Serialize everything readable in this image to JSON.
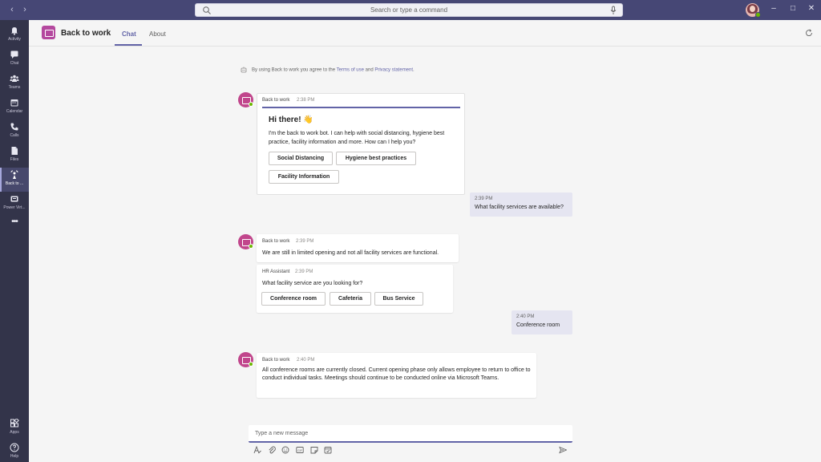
{
  "titlebar": {
    "search_placeholder": "Search or type a command",
    "back": "‹",
    "forward": "›",
    "minimize": "–",
    "maximize": "□",
    "close": "✕"
  },
  "rail": {
    "items": [
      {
        "label": "Activity",
        "icon": "bell-icon"
      },
      {
        "label": "Chat",
        "icon": "chat-icon"
      },
      {
        "label": "Teams",
        "icon": "teams-icon"
      },
      {
        "label": "Calendar",
        "icon": "calendar-icon"
      },
      {
        "label": "Calls",
        "icon": "phone-icon"
      },
      {
        "label": "Files",
        "icon": "file-icon"
      },
      {
        "label": "Back to ...",
        "icon": "back-to-work-icon"
      },
      {
        "label": "Power Virt...",
        "icon": "power-virtual-agents-icon"
      },
      {
        "label": "•••",
        "icon": "more-icon"
      }
    ],
    "apps_label": "Apps",
    "help_label": "Help"
  },
  "header": {
    "title": "Back to work",
    "tabs": [
      "Chat",
      "About"
    ]
  },
  "consent": {
    "prefix": "By using Back to work you agree to the",
    "terms": "Terms of use",
    "and": "and",
    "privacy": "Privacy statement",
    "suffix": "."
  },
  "messages": {
    "m1": {
      "sender": "Back to work",
      "time": "2:38 PM",
      "card_title": "Hi there! 👋",
      "card_text": "I'm the back to work bot.  I can help with social distancing, hygiene best practice, facility information and more.  How can I help you?",
      "buttons": [
        "Social Distancing",
        "Hygiene best practices",
        "Facility Information"
      ]
    },
    "m2": {
      "time": "2:39 PM",
      "text": "What facility services are available?"
    },
    "m3": {
      "sender": "Back to work",
      "time": "2:39 PM",
      "text": "We are still in limited opening and not all facility services are functional."
    },
    "m4": {
      "sender": "HR Assistant",
      "time": "2:39 PM",
      "text": "What facility service are you looking for?",
      "buttons": [
        "Conference room",
        "Cafeteria",
        "Bus Service"
      ]
    },
    "m5": {
      "time": "2:40 PM",
      "text": "Conference room"
    },
    "m6": {
      "sender": "Back to work",
      "time": "2:40 PM",
      "text": "All conference rooms are currently closed. Current opening phase only allows employee to return to office to conduct individual tasks. Meetings should continue to be conducted online via Microsoft Teams."
    }
  },
  "compose": {
    "placeholder": "Type a new message",
    "tools": [
      "format-icon",
      "attach-icon",
      "emoji-icon",
      "gif-icon",
      "sticker-icon",
      "schedule-meeting-icon"
    ]
  },
  "colors": {
    "brand": "#6264a7",
    "titlebar": "#464775",
    "rail": "#33344a",
    "app_icon": "#b4489e",
    "mine_bubble": "#e5e5f1",
    "presence": "#6bb700"
  }
}
